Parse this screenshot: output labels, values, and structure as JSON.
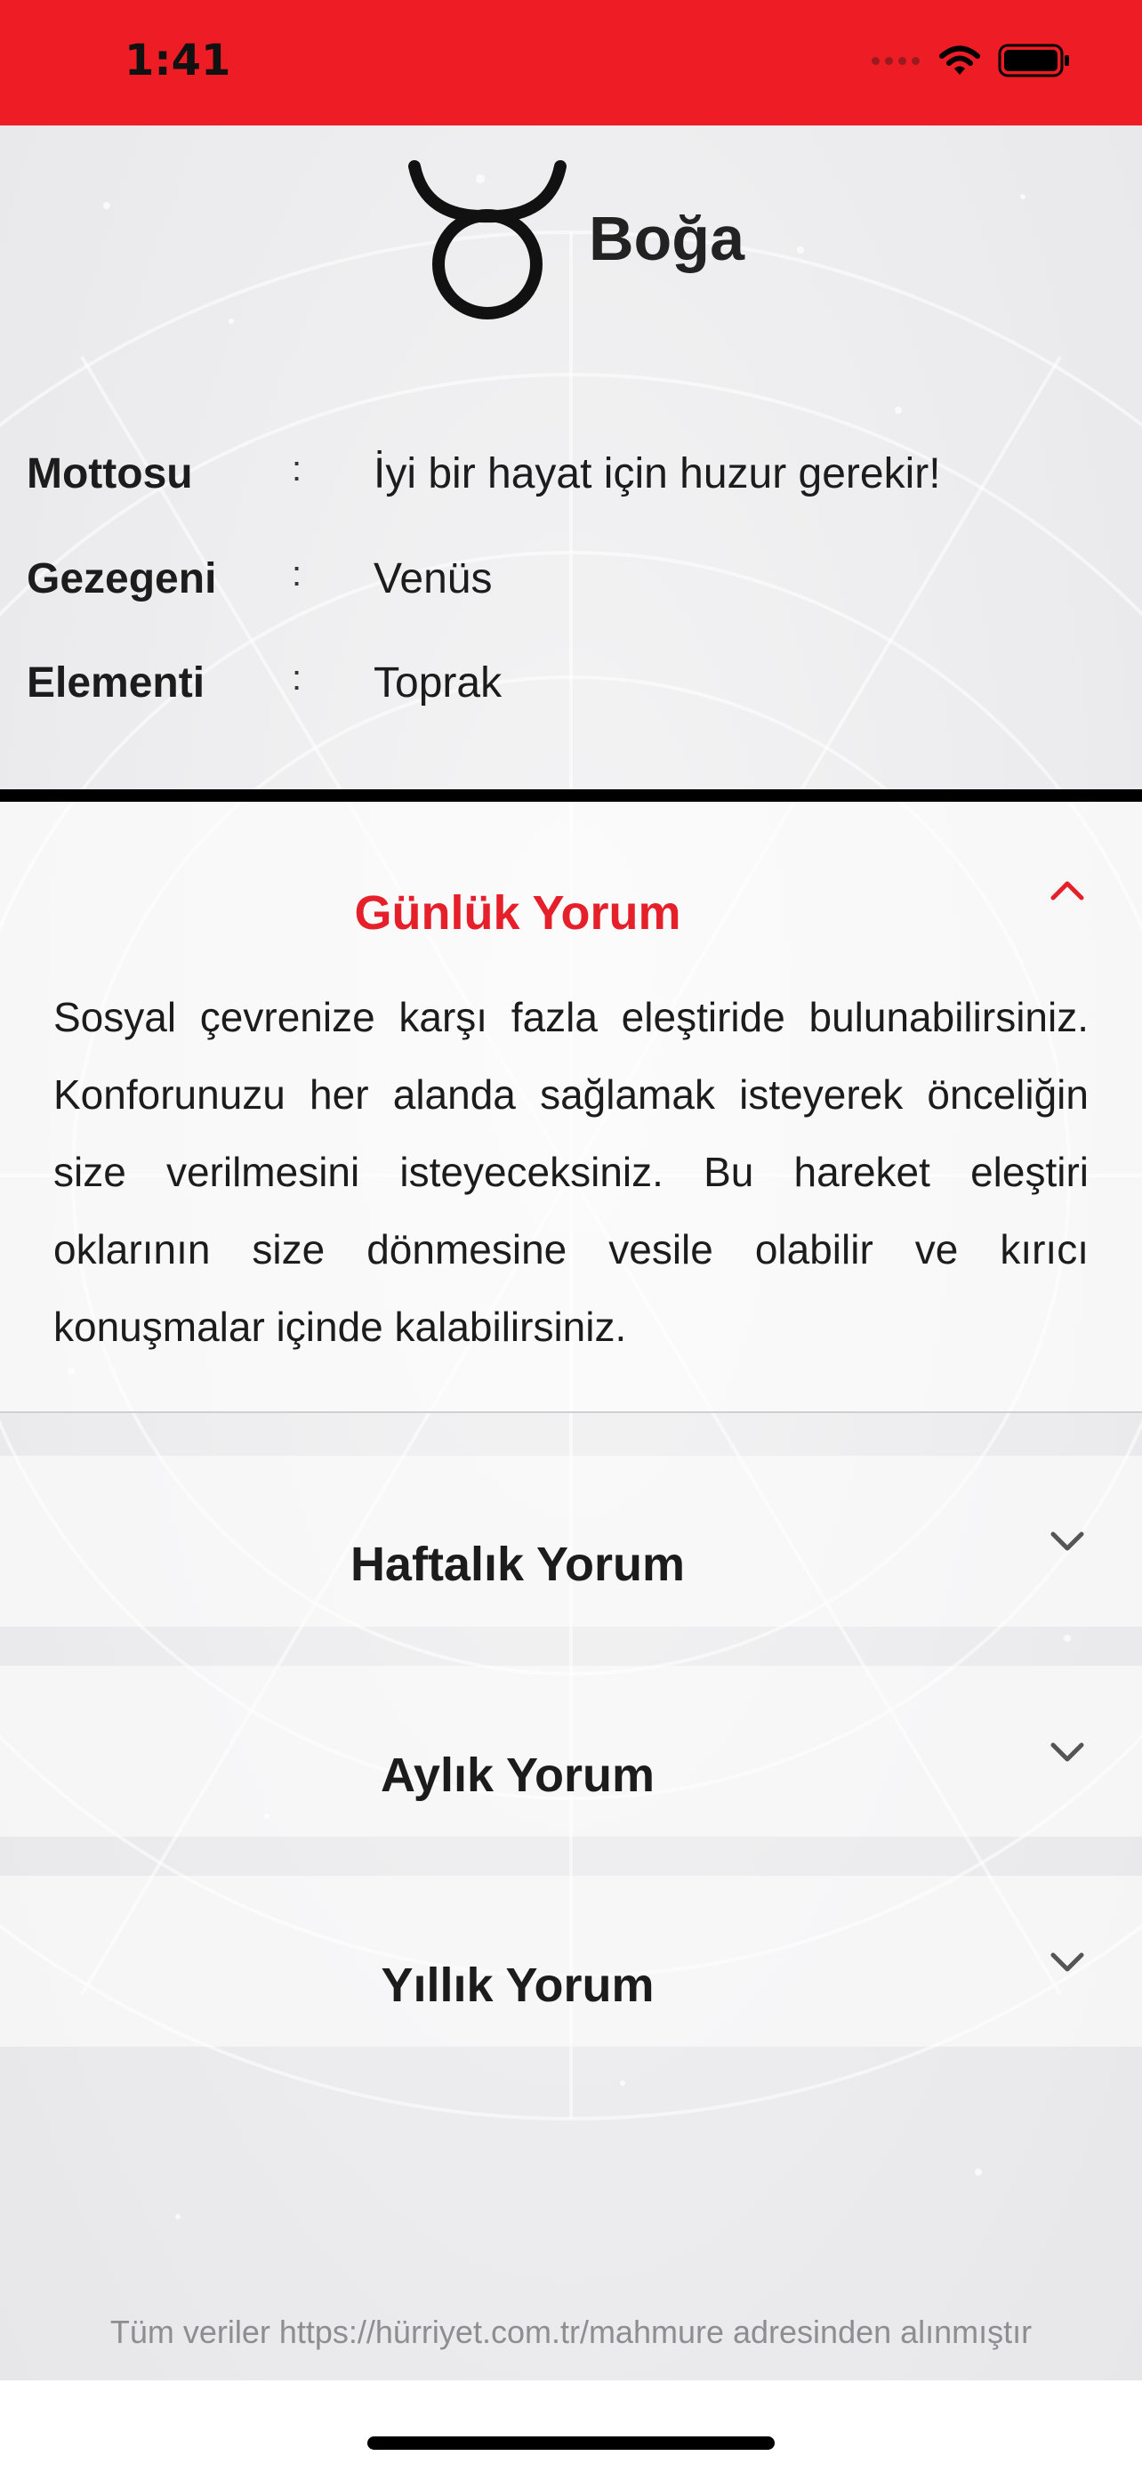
{
  "status_bar": {
    "time": "1:41",
    "color": "#ee1c25"
  },
  "sign": {
    "name": "Boğa",
    "icon": "taurus-icon"
  },
  "info": [
    {
      "label": "Mottosu",
      "colon": ":",
      "value": "İyi bir hayat için huzur gerekir!"
    },
    {
      "label": "Gezegeni",
      "colon": ":",
      "value": "Venüs"
    },
    {
      "label": "Elementi",
      "colon": ":",
      "value": "Toprak"
    }
  ],
  "sections": {
    "daily": {
      "title": "Günlük Yorum",
      "expanded": true,
      "text": "Sosyal çevrenize karşı fazla eleştiride bulunabilirsiniz. Konforunuzu her alanda sağlamak isteyerek önceliğin size verilmesini isteyeceksiniz. Bu hareket eleştiri oklarının size dönmesine vesile olabilir ve kırıcı konuşmalar içinde kalabilirsiniz."
    },
    "weekly": {
      "title": "Haftalık Yorum",
      "expanded": false
    },
    "monthly": {
      "title": "Aylık Yorum",
      "expanded": false
    },
    "yearly": {
      "title": "Yıllık Yorum",
      "expanded": false
    }
  },
  "footer": "Tüm veriler https://hürriyet.com.tr/mahmure adresinden alınmıştır",
  "colors": {
    "accent": "#e5202a",
    "divider": "#000000"
  }
}
